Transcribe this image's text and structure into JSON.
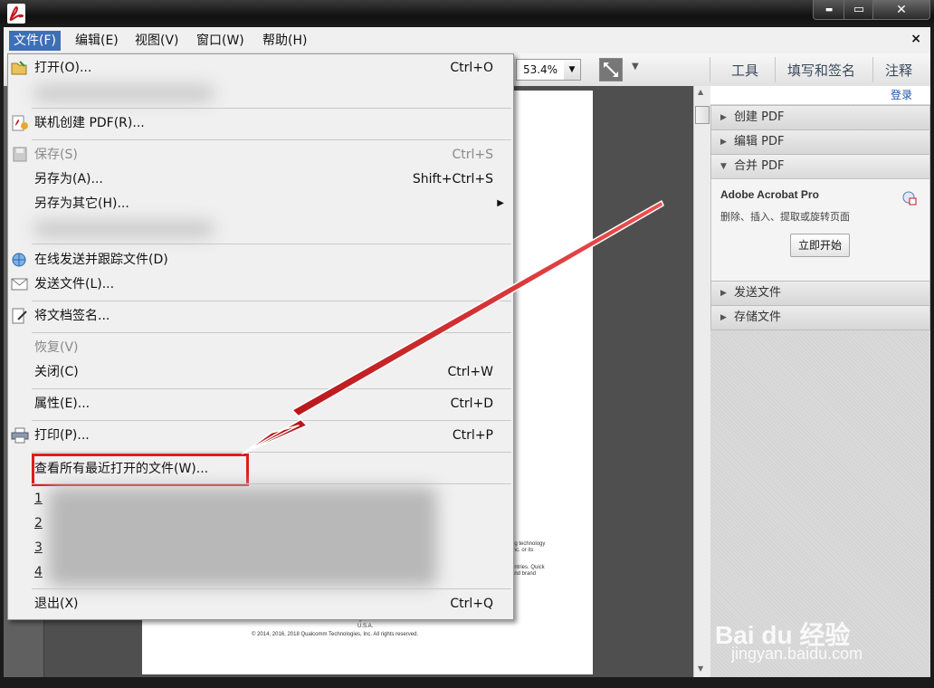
{
  "titlebar": {
    "min": "▬",
    "max": "▭",
    "close": "✕"
  },
  "menubar": {
    "items": [
      "文件(F)",
      "编辑(E)",
      "视图(V)",
      "窗口(W)",
      "帮助(H)"
    ],
    "close": "×"
  },
  "toolbar": {
    "zoom": "53.4%",
    "links": [
      "工具",
      "填写和签名",
      "注释"
    ]
  },
  "file_menu": {
    "items": [
      {
        "label": "打开(O)...",
        "shortcut": "Ctrl+O"
      },
      {
        "label": "联机创建 PDF(R)..."
      },
      {
        "label": "保存(S)",
        "shortcut": "Ctrl+S"
      },
      {
        "label": "另存为(A)...",
        "shortcut": "Shift+Ctrl+S"
      },
      {
        "label": "另存为其它(H)...",
        "submenu": "▶"
      },
      {
        "label": "在线发送并跟踪文件(D)"
      },
      {
        "label": "发送文件(L)..."
      },
      {
        "label": "将文档签名..."
      },
      {
        "label": "恢复(V)"
      },
      {
        "label": "关闭(C)",
        "shortcut": "Ctrl+W"
      },
      {
        "label": "属性(E)...",
        "shortcut": "Ctrl+D"
      },
      {
        "label": "打印(P)...",
        "shortcut": "Ctrl+P"
      },
      {
        "label": "查看所有最近打开的文件(W)..."
      },
      {
        "label": "1"
      },
      {
        "label": "2"
      },
      {
        "label": "3"
      },
      {
        "label": "4"
      },
      {
        "label": "退出(X)",
        "shortcut": "Ctrl+Q"
      }
    ]
  },
  "document": {
    "lines": [
      "ng technology",
      "Inc. or its",
      "untries. Quick",
      "and brand",
      "San Diego, CA 92121",
      "U.S.A.",
      "© 2014, 2016, 2018 Qualcomm Technologies, Inc. All rights reserved."
    ]
  },
  "right_panel": {
    "login": "登录",
    "sections": [
      "创建 PDF",
      "编辑 PDF",
      "合并 PDF",
      "发送文件",
      "存储文件"
    ],
    "product": "Adobe Acrobat Pro",
    "desc": "删除、插入、提取或旋转页面",
    "button": "立即开始"
  },
  "watermark": {
    "brand": "Bai du 经验",
    "url": "jingyan.baidu.com"
  },
  "colors": {
    "highlight": "#dd1c1c",
    "menu_active": "#3d6fb5",
    "link": "#1d55a8"
  }
}
